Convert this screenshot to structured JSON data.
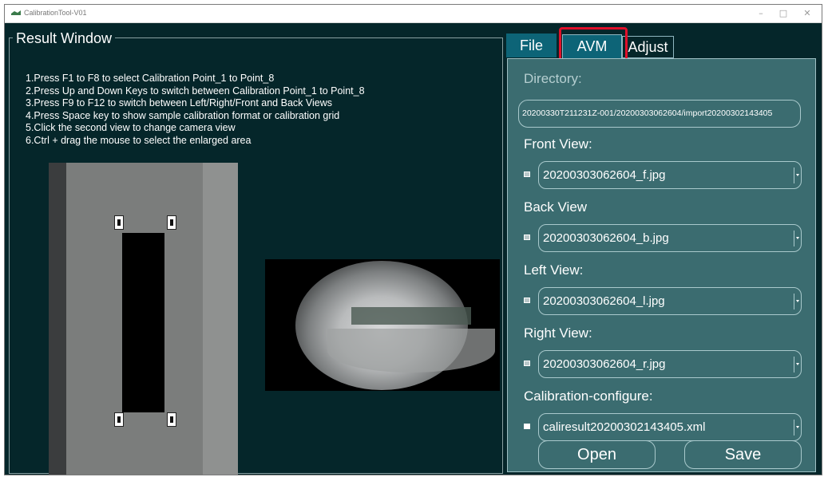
{
  "window": {
    "title": "CalibrationTool-V01",
    "controls": {
      "minimize": "–",
      "maximize": "□",
      "close": "✕"
    }
  },
  "result_window": {
    "title": "Result Window",
    "instructions": [
      "1.Press F1 to F8 to select Calibration Point_1 to Point_8",
      "2.Press Up and Down Keys to switch between Calibration Point_1 to Point_8",
      "3.Press F9 to F12 to switch between Left/Right/Front and Back Views",
      "4.Press Space key to show sample calibration format or calibration grid",
      "5.Click the second view to change camera view",
      "6.Ctrl + drag the mouse to select the enlarged area"
    ]
  },
  "tabs": [
    {
      "label": "File",
      "active": false
    },
    {
      "label": "AVM",
      "active": true,
      "highlighted": true
    },
    {
      "label": "Adjust",
      "active": false
    }
  ],
  "panel": {
    "directory": {
      "label": "Directory:",
      "value": "20200330T211231Z-001/20200303062604/import20200302143405"
    },
    "front_view": {
      "label": "Front View:",
      "checked": true,
      "value": "20200303062604_f.jpg"
    },
    "back_view": {
      "label": "Back View",
      "checked": true,
      "value": "20200303062604_b.jpg"
    },
    "left_view": {
      "label": "Left View:",
      "checked": true,
      "value": "20200303062604_l.jpg"
    },
    "right_view": {
      "label": "Right View:",
      "checked": true,
      "value": "20200303062604_r.jpg"
    },
    "calibration_configure": {
      "label": "Calibration-configure:",
      "checked": false,
      "value": "caliresult20200302143405.xml"
    },
    "open_label": "Open",
    "save_label": "Save"
  },
  "colors": {
    "background": "#05262a",
    "panel": "#3b6c70",
    "tab_active": "#0d6477",
    "highlight": "#e0102a"
  }
}
